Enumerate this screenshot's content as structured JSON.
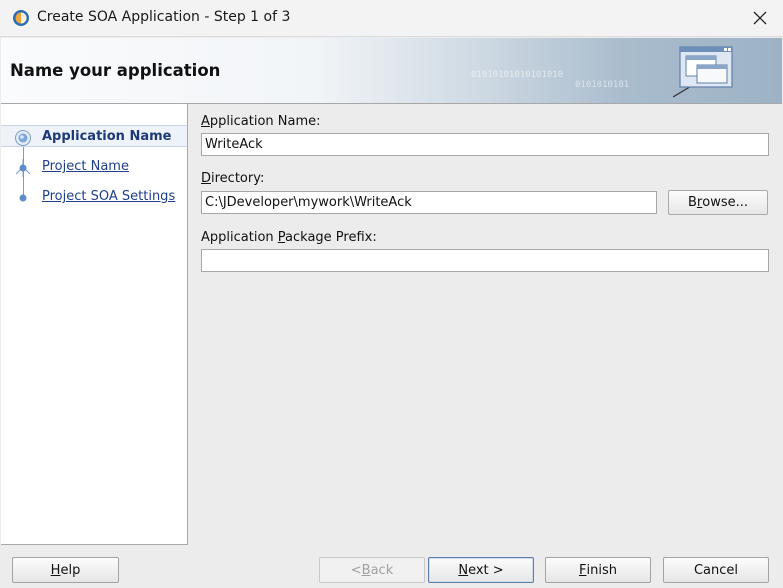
{
  "window": {
    "title": "Create SOA Application - Step 1 of 3",
    "icon": "jdeveloper-icon",
    "close_icon": "close-icon"
  },
  "banner": {
    "title": "Name your application",
    "decoration_text_1": "01010101010101010",
    "decoration_text_2": "0101010101",
    "graphic_icon": "application-windows-icon"
  },
  "steps": [
    {
      "label": "Application Name",
      "state": "current"
    },
    {
      "label": "Project Name",
      "state": "link"
    },
    {
      "label": "Project SOA Settings",
      "state": "link"
    }
  ],
  "form": {
    "app_name": {
      "label_pre": "",
      "label_mnemonic": "A",
      "label_post": "pplication Name:",
      "value": "WriteAck"
    },
    "directory": {
      "label_pre": "",
      "label_mnemonic": "D",
      "label_post": "irectory:",
      "value": "C:\\JDeveloper\\mywork\\WriteAck"
    },
    "browse": {
      "label_pre": "B",
      "label_mnemonic": "r",
      "label_post": "owse..."
    },
    "package_prefix": {
      "label_pre": "Application ",
      "label_mnemonic": "P",
      "label_post": "ackage Prefix:",
      "value": ""
    }
  },
  "footer": {
    "help": {
      "pre": "",
      "mnemonic": "H",
      "post": "elp"
    },
    "back": {
      "pre": "< ",
      "mnemonic": "B",
      "post": "ack",
      "disabled": true
    },
    "next": {
      "pre": "",
      "mnemonic": "N",
      "post": "ext >"
    },
    "finish": {
      "pre": "",
      "mnemonic": "F",
      "post": "inish"
    },
    "cancel": {
      "label": "Cancel"
    }
  },
  "colors": {
    "link": "#1f3f8c",
    "active_step": "#1d3a77",
    "banner_accent": "#9db2c5"
  }
}
